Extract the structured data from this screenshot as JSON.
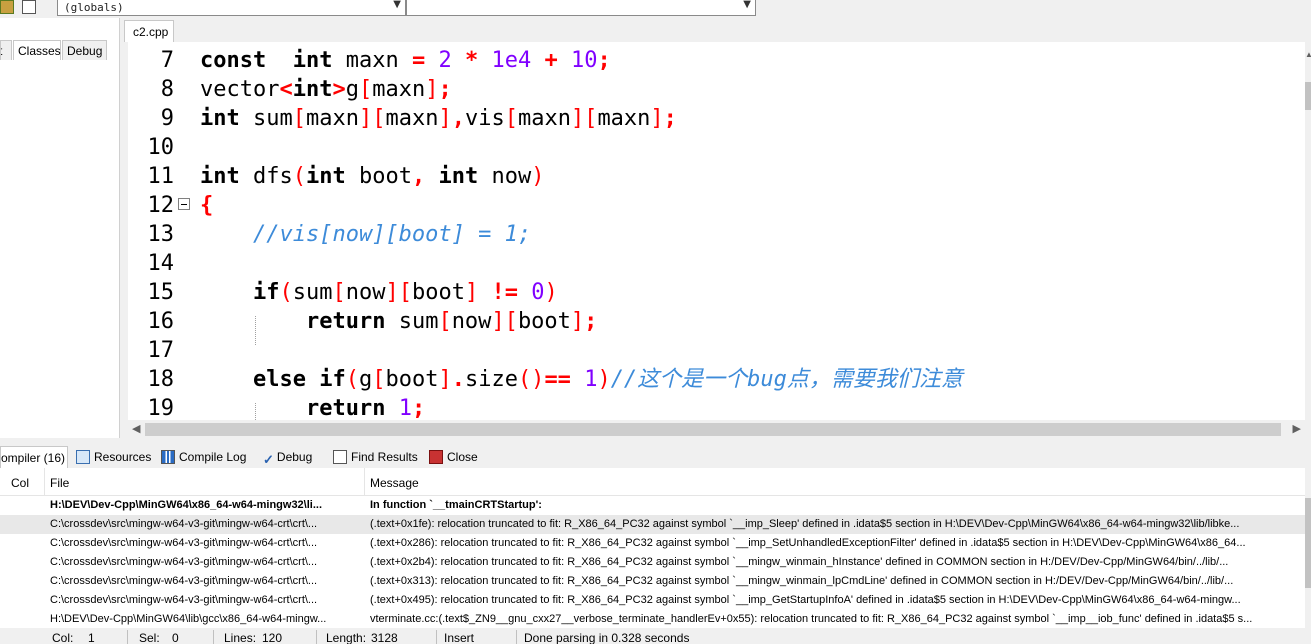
{
  "toolbar": {
    "scope_combo": "(globals)",
    "symbol_combo": ""
  },
  "left_panel": {
    "tabs": [
      {
        "label": "t"
      },
      {
        "label": "Classes"
      },
      {
        "label": "Debug"
      }
    ]
  },
  "editor": {
    "file_tab": "c2.cpp",
    "line_numbers": [
      "7",
      "8",
      "9",
      "10",
      "11",
      "12",
      "13",
      "14",
      "15",
      "16",
      "17",
      "18",
      "19"
    ]
  },
  "bottom_tabs": [
    {
      "label": "ompiler (16)",
      "icon": "compiler-icon"
    },
    {
      "label": "Resources",
      "icon": "resources-icon"
    },
    {
      "label": "Compile Log",
      "icon": "chart-icon"
    },
    {
      "label": "Debug",
      "icon": "check-icon"
    },
    {
      "label": "Find Results",
      "icon": "find-icon"
    },
    {
      "label": "Close",
      "icon": "close-icon"
    }
  ],
  "compiler_table": {
    "columns": {
      "col": "Col",
      "file": "File",
      "message": "Message"
    },
    "rows": [
      {
        "file": "H:\\DEV\\Dev-Cpp\\MinGW64\\x86_64-w64-mingw32\\li...",
        "message": "In function `__tmainCRTStartup':"
      },
      {
        "file": "C:\\crossdev\\src\\mingw-w64-v3-git\\mingw-w64-crt\\crt\\...",
        "message": "(.text+0x1fe): relocation truncated to fit: R_X86_64_PC32 against symbol `__imp_Sleep' defined in .idata$5 section in H:\\DEV\\Dev-Cpp\\MinGW64\\x86_64-w64-mingw32\\lib/libke..."
      },
      {
        "file": "C:\\crossdev\\src\\mingw-w64-v3-git\\mingw-w64-crt\\crt\\...",
        "message": "(.text+0x286): relocation truncated to fit: R_X86_64_PC32 against symbol `__imp_SetUnhandledExceptionFilter' defined in .idata$5 section in H:\\DEV\\Dev-Cpp\\MinGW64\\x86_64..."
      },
      {
        "file": "C:\\crossdev\\src\\mingw-w64-v3-git\\mingw-w64-crt\\crt\\...",
        "message": "(.text+0x2b4): relocation truncated to fit: R_X86_64_PC32 against symbol `__mingw_winmain_hInstance' defined in COMMON section in H:/DEV/Dev-Cpp/MinGW64/bin/../lib/..."
      },
      {
        "file": "C:\\crossdev\\src\\mingw-w64-v3-git\\mingw-w64-crt\\crt\\...",
        "message": "(.text+0x313): relocation truncated to fit: R_X86_64_PC32 against symbol `__mingw_winmain_lpCmdLine' defined in COMMON section in H:/DEV/Dev-Cpp/MinGW64/bin/../lib/..."
      },
      {
        "file": "C:\\crossdev\\src\\mingw-w64-v3-git\\mingw-w64-crt\\crt\\...",
        "message": "(.text+0x495): relocation truncated to fit: R_X86_64_PC32 against symbol `__imp_GetStartupInfoA' defined in .idata$5 section in H:\\DEV\\Dev-Cpp\\MinGW64\\x86_64-w64-mingw..."
      },
      {
        "file": "H:\\DEV\\Dev-Cpp\\MinGW64\\lib\\gcc\\x86_64-w64-mingw...",
        "message": "vterminate.cc:(.text$_ZN9__gnu_cxx27__verbose_terminate_handlerEv+0x55): relocation truncated to fit: R_X86_64_PC32 against symbol `__imp__iob_func' defined in .idata$5 s..."
      }
    ]
  },
  "status_bar": {
    "col_label": "Col:",
    "col_value": "1",
    "sel_label": "Sel:",
    "sel_value": "0",
    "lines_label": "Lines:",
    "lines_value": "120",
    "length_label": "Length:",
    "length_value": "3128",
    "mode": "Insert",
    "message": "Done parsing in 0.328 seconds"
  },
  "colors": {
    "keyword": "#000000",
    "operator": "#ff0000",
    "number": "#8000ff",
    "comment": "#3d8bd9"
  }
}
